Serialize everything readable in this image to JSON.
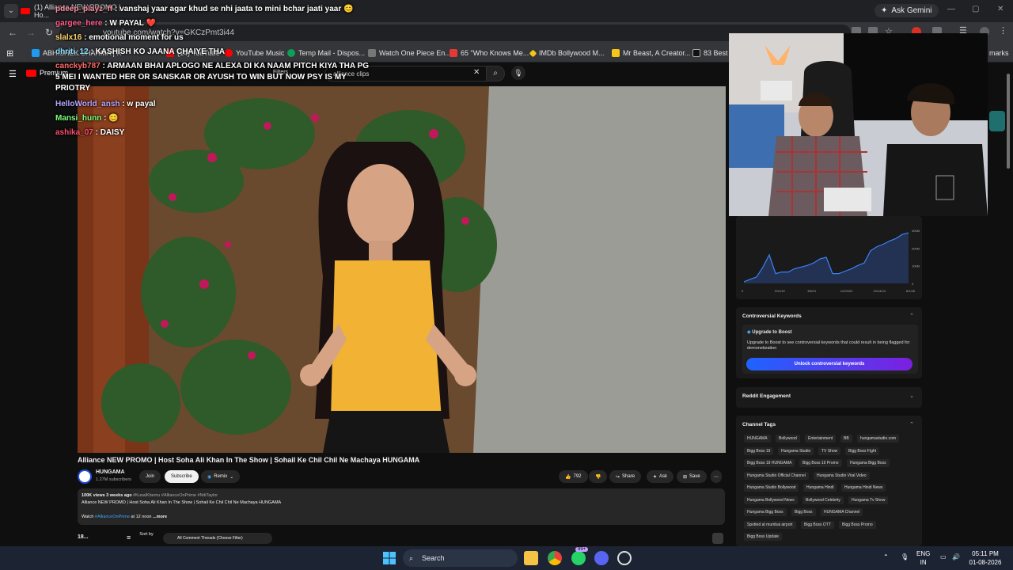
{
  "browser": {
    "tab_title": "(1) Alliance NEW PROMO | Ho...",
    "ask_gemini": "Ask Gemini",
    "url": "youtube.com/watch?v=GKCzPmt3i44",
    "bookmarks": [
      {
        "label": "ABHISHEK SHARMA | X",
        "color": "#1d9bf0"
      },
      {
        "label": "(14) YouTube",
        "color": "#ff0000"
      },
      {
        "label": "YouTube Music",
        "color": "#ff0000"
      },
      {
        "label": "Temp Mail - Dispos...",
        "color": "#0f9d58"
      },
      {
        "label": "Watch One Piece En...",
        "color": "#777777"
      },
      {
        "label": "65 \"Who Knows Me...",
        "color": "#e53935"
      },
      {
        "label": "IMDb Bollywood M...",
        "color": "#f5c518"
      },
      {
        "label": "Mr Beast, A Creator...",
        "color": "#f5c518"
      },
      {
        "label": "83 Best D...",
        "color": "#222222"
      },
      {
        "label": "All Bookmarks",
        "color": "#f5c518"
      }
    ],
    "all_bookmarks": "marks"
  },
  "youtube": {
    "premium_label": "Premium",
    "filters_label": "Filters",
    "search_value": "alliance clips",
    "video_title": "Alliance NEW PROMO | Host Soha Ali Khan In The Show | Sohail Ke Chil Chil Ne Machaya HUNGAMA",
    "channel_name": "HUNGAMA",
    "subscribers": "1.27M subscribers",
    "join": "Join",
    "subscribe": "Subscribe",
    "remix": "Remix",
    "likes": "792",
    "share": "Share",
    "ask": "Ask",
    "save": "Save",
    "desc_stats": "100K views  3 weeks ago",
    "desc_tags": "#KusalKbemu #AllianceOnPrime #NitiTaylor",
    "desc_line": "Alliance NEW PROMO | Host Soha Ali Khan In The Show | Sohail Ke Chil Chil Ne Machaya HUNGAMA",
    "desc_watch_prefix": "Watch ",
    "desc_watch_link": "#AllianceOnPrime",
    "desc_watch_suffix": " at 12 noon",
    "desc_more": "...more",
    "comments_count": "18...",
    "sort_by": "Sort by",
    "comment_filter": "All Comment Threads (Choose Filter)"
  },
  "chat": [
    {
      "user": "gargee_here",
      "user_color": "#ff5c8a",
      "text": " : W PAYAL ❤️"
    },
    {
      "user": "slalx16",
      "user_color": "#ffd36b",
      "text": " : emotional moment for us"
    },
    {
      "user": "dhriti_12",
      "user_color": "#8be0ff",
      "text": " : KASHISH KO JAANA CHAIYE THA"
    },
    {
      "user": "canckyb787",
      "user_color": "#ff6a6a",
      "text": " : ARMAAN BHAI APLOGO NE ALEXA DI KA NAAM PITCH KIYA THA PG 5 MEI I WANTED HER OR SANSKAR OR AYUSH TO WIN BUT NOW PSY IS MY PRIOTRY"
    },
    {
      "user": "HelloWorld_ansh",
      "user_color": "#b8a6ff",
      "text": " : w payal"
    },
    {
      "user": "Mansi_hunn",
      "user_color": "#7dff7d",
      "text": " : 😊"
    },
    {
      "user": "ashika_07",
      "user_color": "#ff4d6d",
      "text": " : DAISY"
    }
  ],
  "chat_top": {
    "user": "pdeep_playz_ff",
    "text": " : vanshaj yaar agar khud se nhi jaata to mini bchar jaati yaar 😊"
  },
  "sidebar": {
    "chart_ticks_y": [
      "400M",
      "200M",
      "100M",
      "0"
    ],
    "chart_ticks_x": [
      "0",
      "2/11/19",
      "3/6/21",
      "12/20/22",
      "10/14/24",
      "8/1/26"
    ],
    "controversial_title": "Controversial Keywords",
    "upgrade_title": "Upgrade to Boost",
    "upgrade_text": "Upgrade to Boost to see controversial keywords that could result in being flagged for demonetization",
    "unlock_button": "Unlock controversial keywords",
    "reddit_title": "Reddit Engagement",
    "tags_title": "Channel Tags",
    "tags": [
      "HUNGAMA",
      "Bollywood",
      "Entertainment",
      "BB",
      "hungamastudio.com",
      "Bigg Boss 19",
      "Hungama Studio",
      "TV Show",
      "Bigg Boss Fight",
      "Bigg Boss 19 HUNGAMA",
      "Bigg Boss 19 Promo",
      "Hungama Bigg Boss",
      "Hungama Studio Official Channel",
      "Hungama Studio Viral Video",
      "Hungama Studio Bollywood",
      "Hungama Hindi",
      "Hungama Hindi News",
      "Hungama Bollywood News",
      "Bollywood Celebrity",
      "Hungama Tv Show",
      "Hungama Bigg Boss",
      "Bigg Boss",
      "HUNGAMA Channel",
      "Spotted at mumbai airport",
      "Bigg Boss OTT",
      "Bigg Boss Promo",
      "Bigg Boss Update"
    ]
  },
  "taskbar": {
    "search": "Search",
    "badge": "99+",
    "lang_top": "ENG",
    "lang_bottom": "IN",
    "time": "05:11 PM",
    "date": "01-08-2026"
  },
  "chart_data": {
    "type": "line",
    "title": "",
    "x_ticks": [
      "0",
      "2/11/19",
      "3/6/21",
      "12/20/22",
      "10/14/24",
      "8/1/26"
    ],
    "y_ticks": [
      "0",
      "100M",
      "200M",
      "400M"
    ],
    "series": [
      {
        "values": [
          2,
          5,
          8,
          20,
          35,
          12,
          14,
          14,
          18,
          20,
          22,
          25,
          30,
          32,
          12,
          12,
          15,
          18,
          22,
          25,
          40,
          45,
          48,
          52,
          55,
          60,
          62
        ]
      }
    ]
  },
  "colors": {
    "accent": "#3ea6ff",
    "unlock_gradient_a": "#1e64ff",
    "unlock_gradient_b": "#7c1fe0",
    "yt_red": "#ff0000"
  }
}
